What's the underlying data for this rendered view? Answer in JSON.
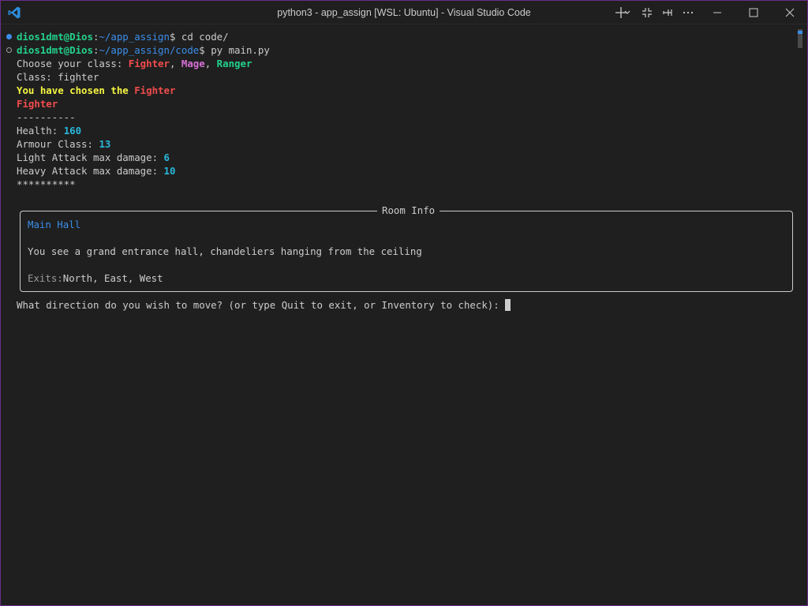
{
  "window": {
    "title": "python3 - app_assign [WSL: Ubuntu] - Visual Studio Code"
  },
  "terminal": {
    "prompt1": {
      "user": "dios1dmt@Dios",
      "path": "~/app_assign",
      "cmd": "$ cd code/"
    },
    "prompt2": {
      "user": "dios1dmt@Dios",
      "path": "~/app_assign/code",
      "cmd": "$ py main.py"
    },
    "choose_prefix": "Choose your class: ",
    "class_options": [
      "Fighter",
      "Mage",
      "Ranger"
    ],
    "class_input_label": "Class: fighter",
    "chosen_prefix": "You have chosen the ",
    "chosen_class": "Fighter",
    "class_heading": "Fighter",
    "separator_dash": "----------",
    "stats": [
      {
        "label": "Health: ",
        "value": "160"
      },
      {
        "label": "Armour Class: ",
        "value": "13"
      },
      {
        "label": "Light Attack max damage: ",
        "value": "6"
      },
      {
        "label": "Heavy Attack max damage: ",
        "value": "10"
      }
    ],
    "separator_star": "**********",
    "room": {
      "box_title": "Room Info",
      "name": "Main Hall",
      "description": "You see a grand entrance hall, chandeliers hanging from the ceiling",
      "exits_label": "Exits:",
      "exits": "North, East, West"
    },
    "input_prompt": "What direction do you wish to move? (or type Quit to exit, or Inventory to check): "
  },
  "colors": {
    "accent_blue": "#3b8eea",
    "green": "#23d18b",
    "red": "#f14c4c",
    "magenta": "#d670d6",
    "yellow": "#f5f543",
    "cyan": "#29b8db"
  }
}
